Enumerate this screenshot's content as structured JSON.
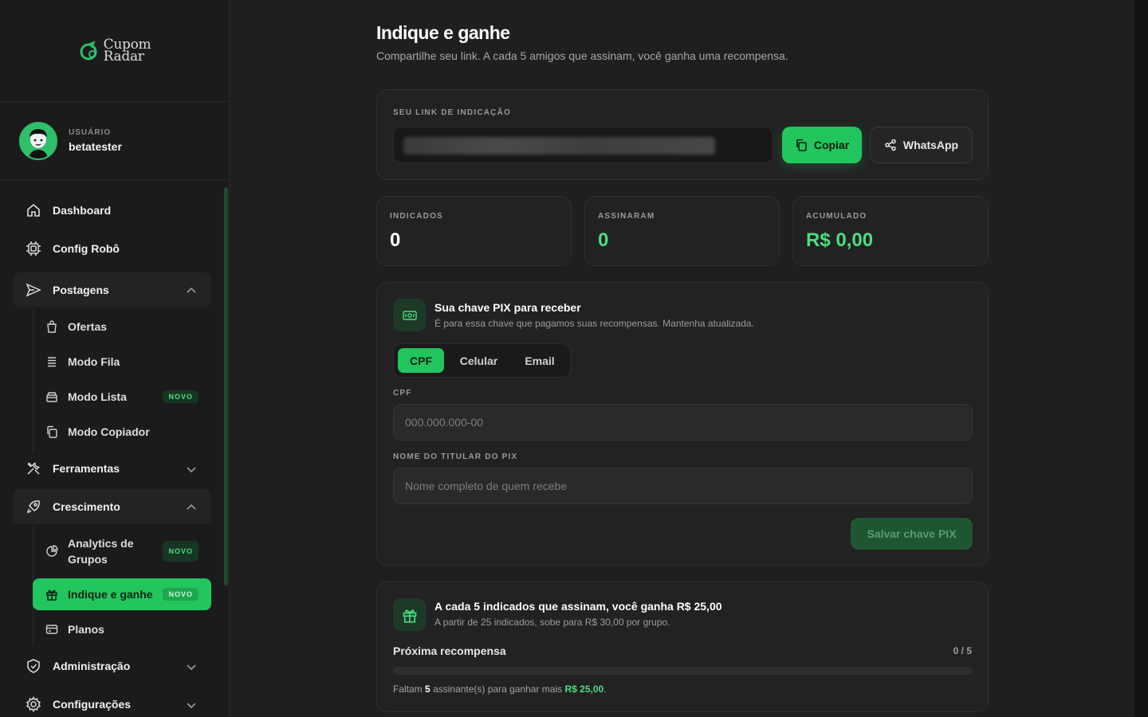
{
  "brand": {
    "name_line1": "Cupom",
    "name_line2": "Radar"
  },
  "user": {
    "label": "USUÁRIO",
    "name": "betatester"
  },
  "nav": {
    "dashboard": "Dashboard",
    "config_robo": "Config Robô",
    "postagens": "Postagens",
    "postagens_items": [
      "Ofertas",
      "Modo Fila",
      "Modo Lista",
      "Modo Copiador"
    ],
    "ferramentas": "Ferramentas",
    "crescimento": "Crescimento",
    "crescimento_items": [
      "Analytics de Grupos",
      "Indique e ganhe",
      "Planos"
    ],
    "administracao": "Administração",
    "configuracoes": "Configurações",
    "badge_new": "NOVO"
  },
  "page": {
    "title": "Indique e ganhe",
    "subtitle": "Compartilhe seu link. A cada 5 amigos que assinam, você ganha uma recompensa."
  },
  "link": {
    "label": "SEU LINK DE INDICAÇÃO",
    "copy_button": "Copiar",
    "whatsapp_button": "WhatsApp"
  },
  "stats": [
    {
      "label": "INDICADOS",
      "value": "0"
    },
    {
      "label": "ASSINARAM",
      "value": "0"
    },
    {
      "label": "ACUMULADO",
      "value": "R$ 0,00"
    }
  ],
  "pix": {
    "title": "Sua chave PIX para receber",
    "description": "É para essa chave que pagamos suas recompensas. Mantenha atualizada.",
    "types": [
      "CPF",
      "Celular",
      "Email"
    ],
    "selected_type": "CPF",
    "key_label": "CPF",
    "key_placeholder": "000.000.000-00",
    "holder_label": "NOME DO TITULAR DO PIX",
    "holder_placeholder": "Nome completo de quem recebe",
    "save_button": "Salvar chave PIX"
  },
  "reward": {
    "title": "A cada 5 indicados que assinam, você ganha R$ 25,00",
    "description": "A partir de 25 indicados, sobe para R$ 30,00 por grupo.",
    "next_label": "Próxima recompensa",
    "progress_text": "0 / 5",
    "progress_fraction": 0,
    "note_prefix": "Faltam",
    "note_count": "5",
    "note_middle": "assinante(s) para ganhar mais",
    "note_amount": "R$ 25,00",
    "note_suffix": "."
  },
  "colors": {
    "accent": "#22c55e",
    "accent_text": "#4ade80",
    "background": "#1f1f1f",
    "sidebar": "#1b1b1b"
  }
}
